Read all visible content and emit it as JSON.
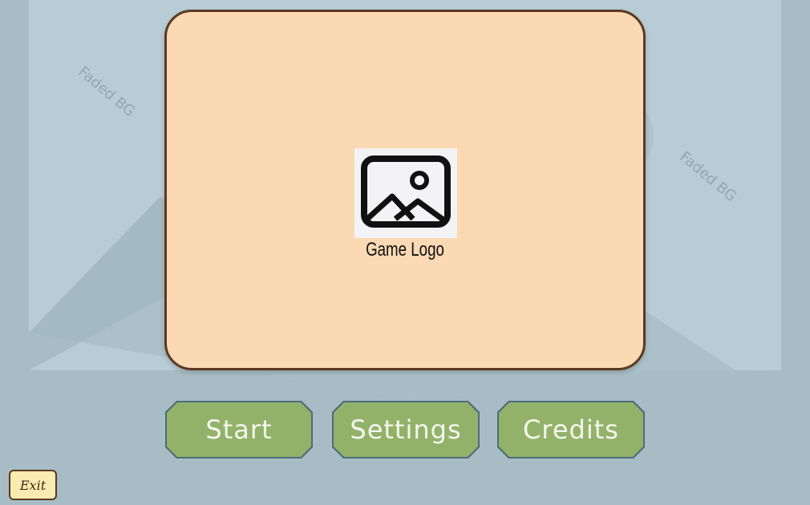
{
  "background": {
    "watermark_left": "Faded BG",
    "watermark_right": "Faded BG"
  },
  "logo": {
    "icon": "image-placeholder-icon",
    "caption": "Game Logo"
  },
  "menu": {
    "start_label": "Start",
    "settings_label": "Settings",
    "credits_label": "Credits"
  },
  "exit_label": "Exit",
  "colors": {
    "background": "#a8bcc5",
    "panel_fill": "#fad9b3",
    "panel_border": "#5a3a22",
    "button_fill": "#92b26a",
    "button_text": "#f4f7ec",
    "exit_fill": "#fbebb0"
  }
}
